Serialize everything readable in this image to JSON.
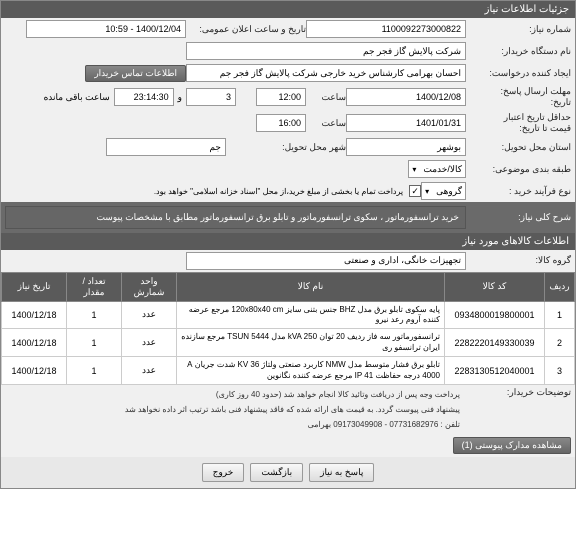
{
  "header1": "جزئیات اطلاعات نیاز",
  "need_no_lbl": "شماره نیاز:",
  "need_no": "1100092273000822",
  "public_time_lbl": "تاریخ و ساعت اعلان عمومی:",
  "public_time": "1400/12/04 - 10:59",
  "buyer_lbl": "نام دستگاه خریدار:",
  "buyer": "شرکت پالایش گاز فجر جم",
  "creator_lbl": "ایجاد کننده درخواست:",
  "creator": "احسان بهرامی کارشناس خرید خارجی شرکت پالایش گاز فجر جم",
  "contact_btn": "اطلاعات تماس خریدار",
  "reply_deadline_lbl": "مهلت ارسال پاسخ:",
  "reply_deadline_t_lbl": "تاریخ:",
  "reply_date": "1400/12/08",
  "hour_lbl": "ساعت",
  "reply_hour": "12:00",
  "remain_lbl": "ساعت باقی مانده",
  "remain_val": "23:14:30",
  "days_val": "3",
  "valid_lbl": "حداقل تاریخ اعتبار",
  "valid_lbl2": "قیمت تا تاریخ:",
  "valid_date": "1401/01/31",
  "valid_hour": "16:00",
  "province_lbl": "استان محل تحویل:",
  "province": "بوشهر",
  "city_lbl": "شهر محل تحویل:",
  "city": "جم",
  "pkg_lbl": "طبقه بندی موضوعی:",
  "pkg": "کالا/خدمت",
  "purchase_type_lbl": "نوع فرآیند خرید :",
  "purchase_type": "گروهی",
  "purchase_note": "پرداخت تمام یا بخشی از مبلغ خرید،از محل \"اسناد خزانه اسلامی\" خواهد بود.",
  "desc_lbl": "شرح کلی نیاز:",
  "desc": "خرید ترانسفورماتور ، سکوی ترانسفورماتور و تابلو برق ترانسفورماتور\nمطابق با مشخصات پیوست",
  "header2": "اطلاعات کالاهای مورد نیاز",
  "group_lbl": "گروه کالا:",
  "group": "تجهیزات خانگی، اداری و صنعتی",
  "cols": {
    "row": "ردیف",
    "code": "کد کالا",
    "name": "نام کالا",
    "unit": "واحد شمارش",
    "qty": "تعداد / مقدار",
    "date": "تاریخ نیاز"
  },
  "items": [
    {
      "row": "1",
      "code": "0934800019800001",
      "name": "پایه سکوی تابلو برق مدل BHZ جنس بتنی سایز 120x80x40 cm مرجع عرضه کننده آروم رعد نیرو",
      "unit": "عدد",
      "qty": "1",
      "date": "1400/12/18"
    },
    {
      "row": "2",
      "code": "2282220149330039",
      "name": "ترانسفورماتور سه فاز ردیف 20 توان kVA 250 مدل TSUN 5444 مرجع سازنده ایران ترانسفو ری",
      "unit": "عدد",
      "qty": "1",
      "date": "1400/12/18"
    },
    {
      "row": "3",
      "code": "2283130512040001",
      "name": "تابلو برق فشار متوسط مدل NMW کاربرد صنعتی ولتاژ KV 36 شدت جریان A 4000 درجه حفاظت IP 41 مرجع عرضه کننده نگانوین",
      "unit": "عدد",
      "qty": "1",
      "date": "1400/12/18"
    }
  ],
  "note1": "پرداخت وجه پس از دریافت وتائید کالا انجام خواهد شد (حدود 40 روز کاری)",
  "note2": "پیشنهاد فنی پیوست گردد. به قیمت های ارائه شده که فاقد پیشنهاد فنی باشد ترتیب اثر داده نخواهد شد",
  "note3": "تلفن : 07731682976 - 09173049908 بهرامی",
  "attach_btn": "مشاهده مدارک پیوستی (1)",
  "btn_reply": "پاسخ به نیاز",
  "btn_back": "بازگشت",
  "btn_exit": "خروج",
  "remarks_lbl": "توضیحات خریدار:",
  "check": "✓"
}
